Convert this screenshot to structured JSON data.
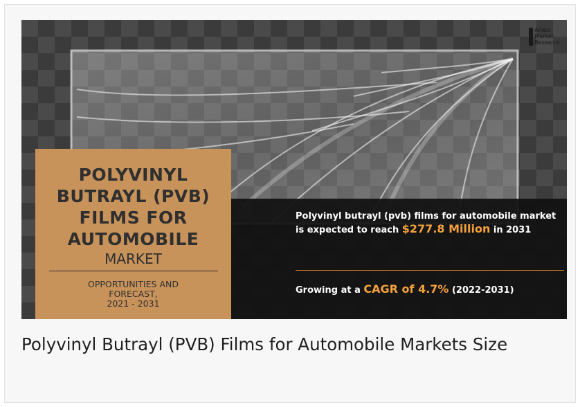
{
  "logo": {
    "lines": [
      "Allied",
      "Market",
      "Research"
    ]
  },
  "banner": {
    "title_lines": [
      "POLYVINYL",
      "BUTRAYL (PVB)",
      "FILMS FOR",
      "AUTOMOBILE"
    ],
    "market_word": "MARKET",
    "opportunities_lines": [
      "OPPORTUNITIES AND",
      "FORECAST,",
      "2021 - 2031"
    ],
    "reach_pre": "Polyvinyl butrayl (pvb) films for automobile market is expected to reach",
    "reach_value": "$277.8 Million",
    "reach_post": "in 2031",
    "cagr_pre": "Growing at a",
    "cagr_value": "CAGR of 4.7%",
    "cagr_post": "(2022-2031)"
  },
  "caption": "Polyvinyl Butrayl (PVB) Films for Automobile Markets Size",
  "colors": {
    "accent_orange": "#f5a23a",
    "box_tan": "#c8935b",
    "panel_dark": "#121212"
  }
}
